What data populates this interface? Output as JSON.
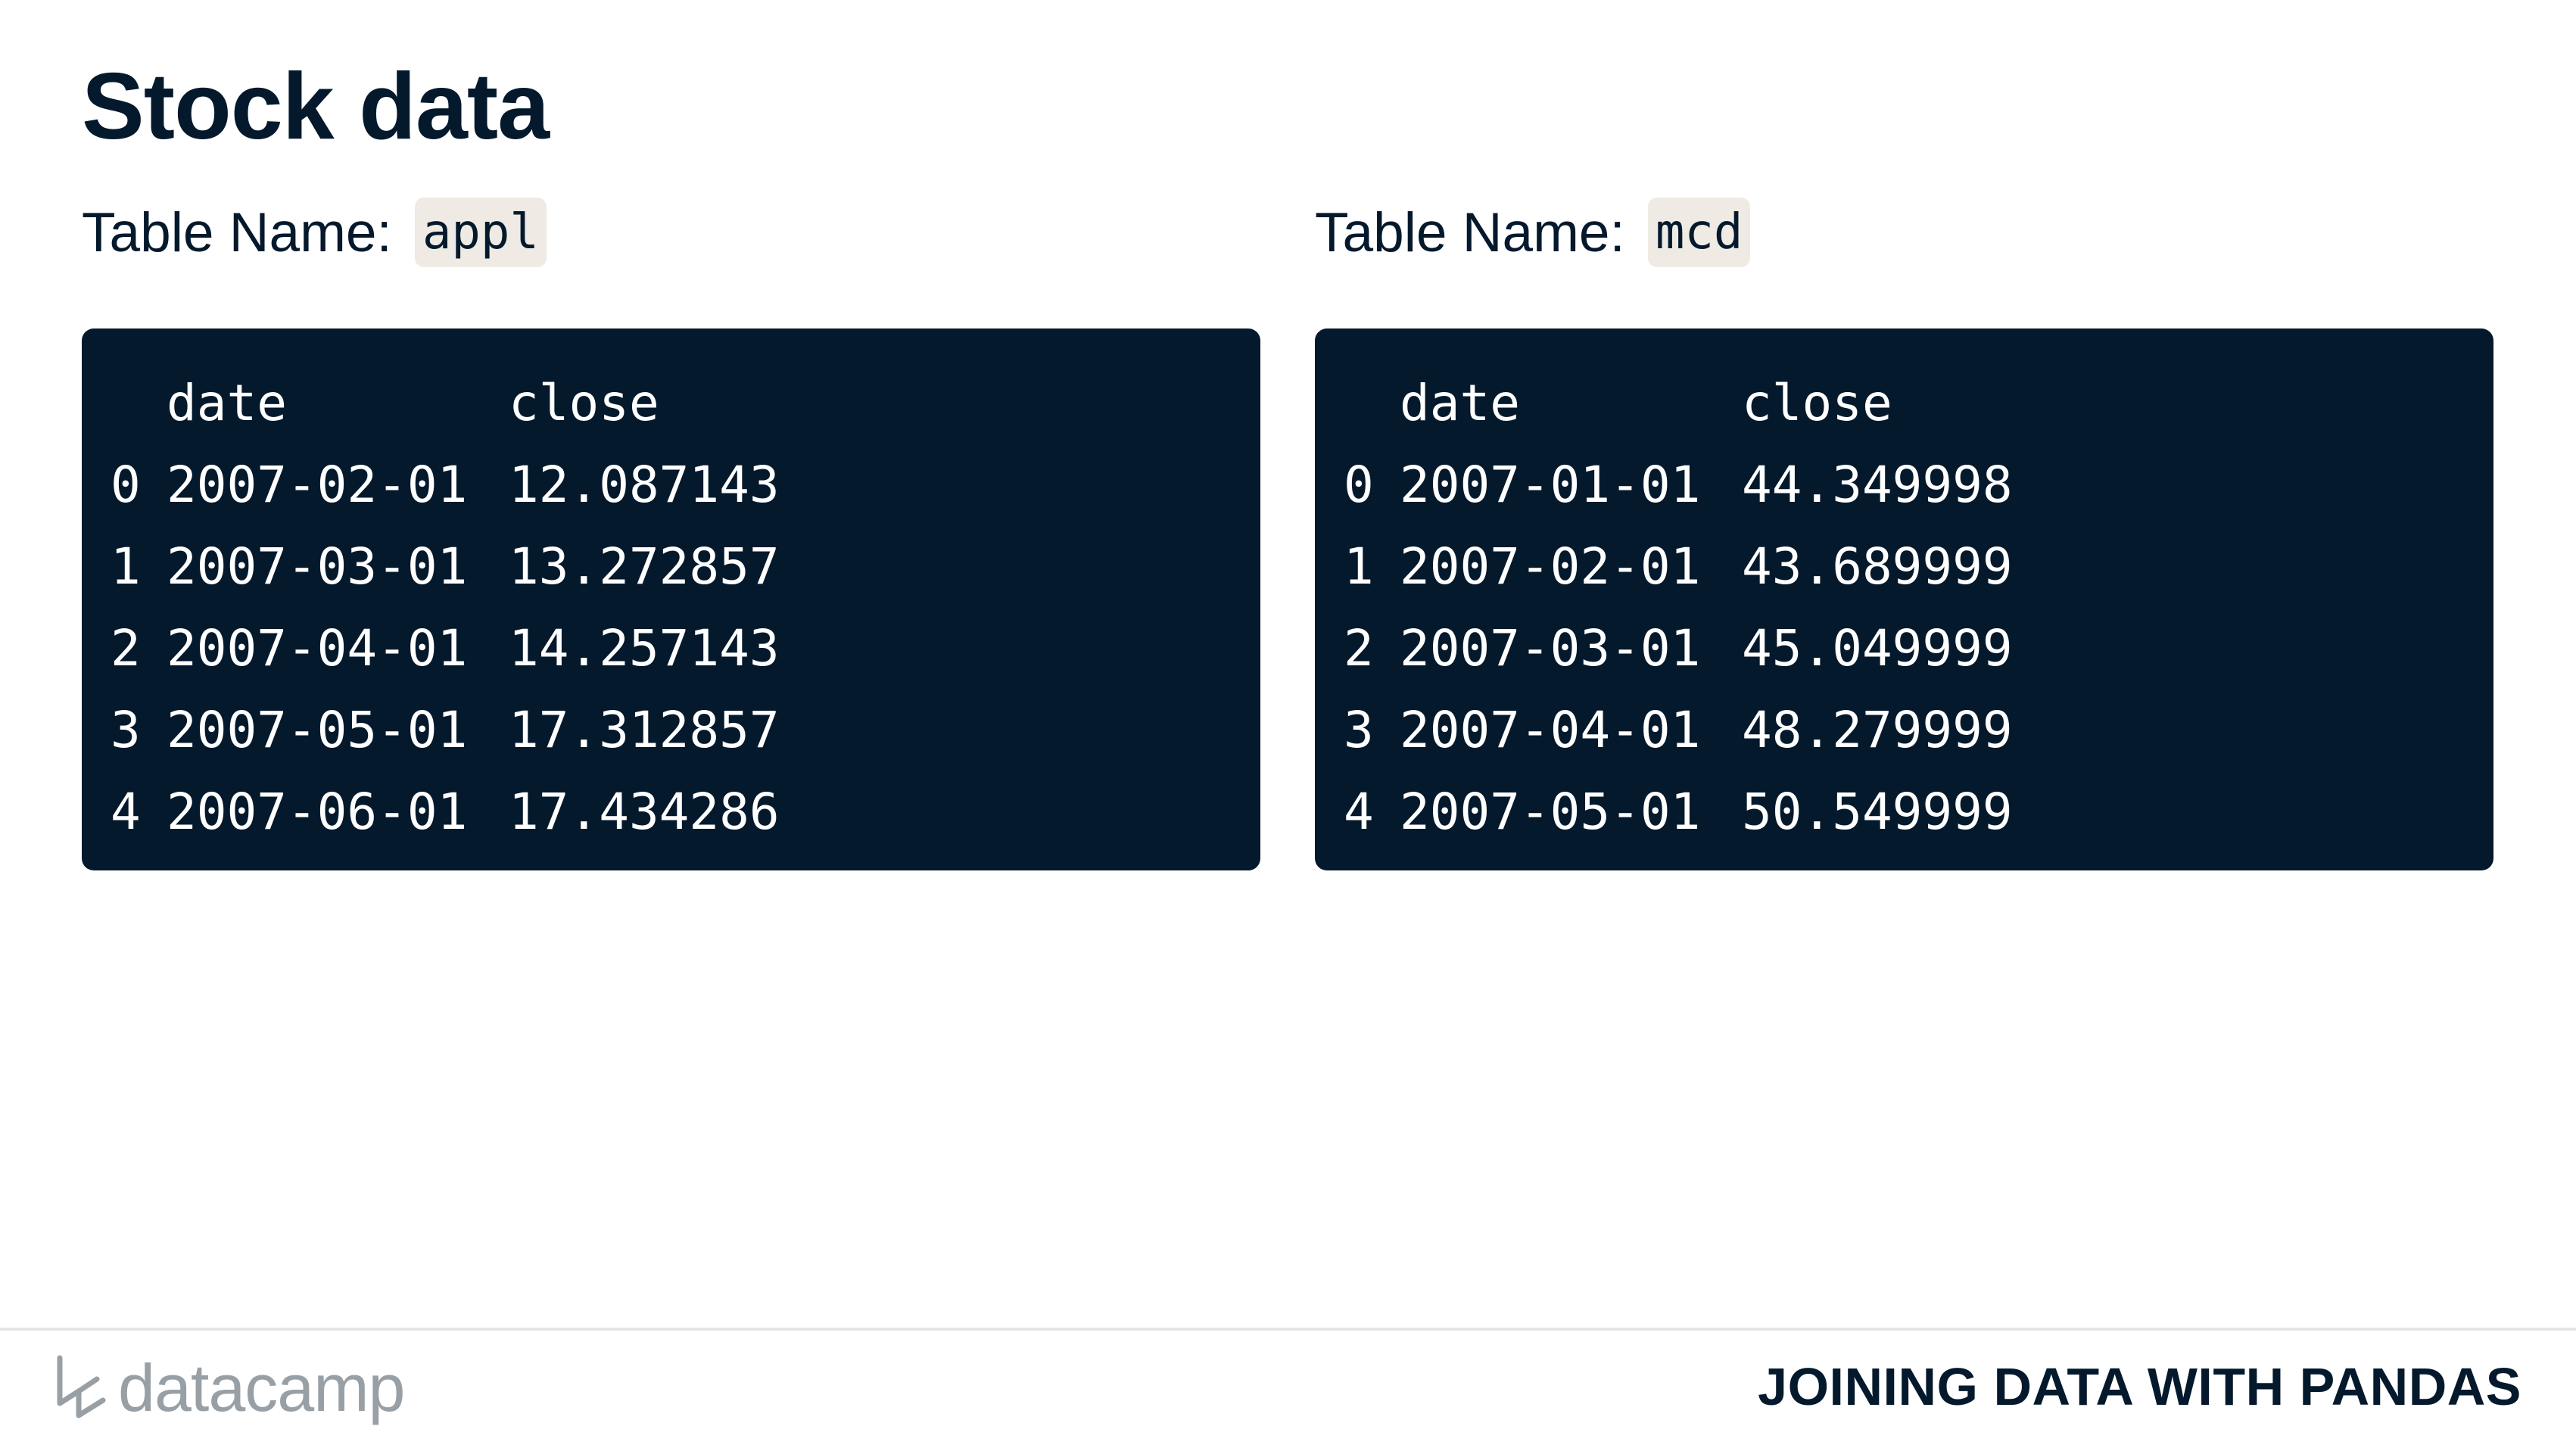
{
  "title": "Stock data",
  "tables": [
    {
      "label": "Table Name:",
      "name": "appl",
      "columns": [
        "",
        "date",
        "close"
      ],
      "rows": [
        [
          "0",
          "2007-02-01",
          "12.087143"
        ],
        [
          "1",
          "2007-03-01",
          "13.272857"
        ],
        [
          "2",
          "2007-04-01",
          "14.257143"
        ],
        [
          "3",
          "2007-05-01",
          "17.312857"
        ],
        [
          "4",
          "2007-06-01",
          "17.434286"
        ]
      ]
    },
    {
      "label": "Table Name:",
      "name": "mcd",
      "columns": [
        "",
        "date",
        "close"
      ],
      "rows": [
        [
          "0",
          "2007-01-01",
          "44.349998"
        ],
        [
          "1",
          "2007-02-01",
          "43.689999"
        ],
        [
          "2",
          "2007-03-01",
          "45.049999"
        ],
        [
          "3",
          "2007-04-01",
          "48.279999"
        ],
        [
          "4",
          "2007-05-01",
          "50.549999"
        ]
      ]
    }
  ],
  "footer": {
    "brand": "datacamp",
    "brand_icon": "datacamp-logo-icon",
    "course": "JOINING DATA WITH PANDAS"
  },
  "colors": {
    "navy": "#05192d",
    "code_chip": "#efebe4",
    "brand_gray": "#98a0a6"
  }
}
